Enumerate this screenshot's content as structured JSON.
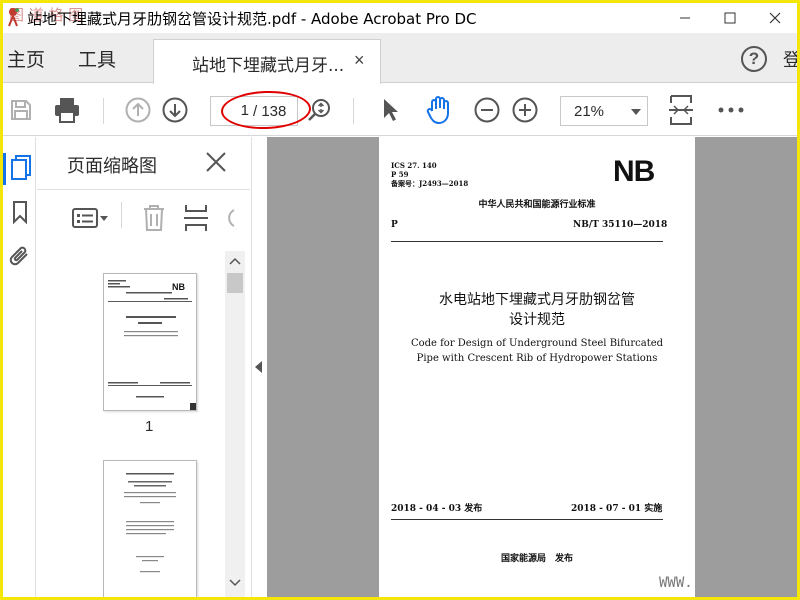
{
  "window": {
    "title": "站地下埋藏式月牙肋钢岔管设计规范.pdf - Adobe Acrobat Pro DC",
    "corner_watermark": "图  道  格  图",
    "minimize": "—",
    "maximize": "☐",
    "close": "✕"
  },
  "menu": {
    "home": "主页",
    "tools": "工具",
    "doc_tab": "站地下埋藏式月牙...",
    "doc_tab_close": "×",
    "help": "?",
    "signin_partial": "登"
  },
  "toolbar": {
    "page_current": "1",
    "page_total": "/ 138",
    "zoom": "21%"
  },
  "icons": {
    "save": "save-icon",
    "print": "print-icon",
    "prev_page": "arrow-up-circle-icon",
    "next_page": "arrow-down-circle-icon",
    "find": "zoom-search-icon",
    "select": "cursor-arrow-icon",
    "hand": "hand-icon",
    "zoom_out": "minus-circle-icon",
    "zoom_in": "plus-circle-icon",
    "fit_page": "fit-page-icon",
    "more": "more-icon"
  },
  "thumbnails_panel": {
    "title": "页面缩略图",
    "pages": [
      {
        "label": "1"
      }
    ]
  },
  "document_page": {
    "ics": "ICS 27. 140",
    "p_code": "P 59",
    "record": "备案号：J2493—2018",
    "logo": "NB",
    "industry_std": "中华人民共和国能源行业标准",
    "left_code": "P",
    "std_number": "NB/T 35110—2018",
    "title_cn_1": "水电站地下埋藏式月牙肋钢岔管",
    "title_cn_2": "设计规范",
    "title_en_1": "Code for Design of Underground Steel Bifurcated",
    "title_en_2": "Pipe with Crescent Rib of Hydropower Stations",
    "issue_date": "2018 - 04 - 03 发布",
    "impl_date": "2018 - 07 - 01 实施",
    "issuer": "国家能源局　发布"
  },
  "watermark_bottom": "WWW.",
  "colors": {
    "accent": "#1473e6",
    "annotation_red": "#e00000",
    "frame_yellow": "#f5e60a",
    "doc_bg": "#9d9d9d"
  }
}
